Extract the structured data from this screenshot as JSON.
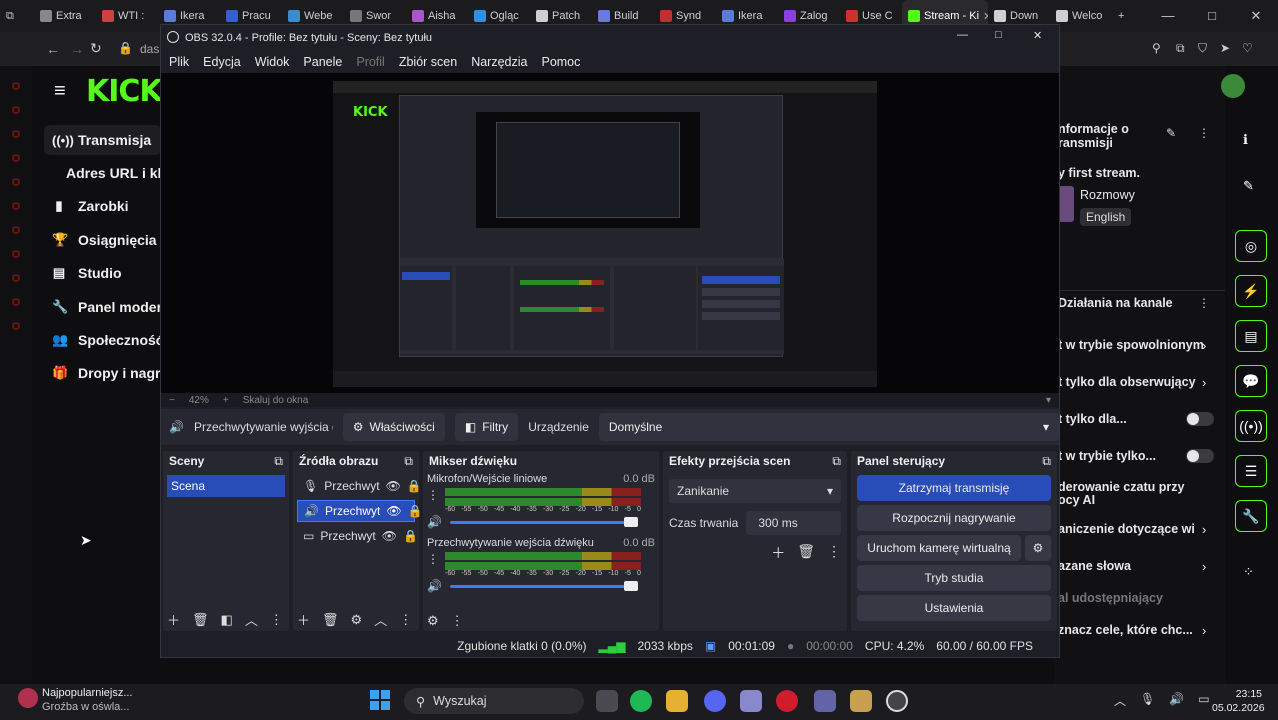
{
  "browser": {
    "tabs": [
      {
        "label": "Extra",
        "color": "#888888"
      },
      {
        "label": "WTI :",
        "color": "#d04040"
      },
      {
        "label": "Ikera",
        "color": "#5a7bd8"
      },
      {
        "label": "Pracu",
        "color": "#3460d0"
      },
      {
        "label": "Webe",
        "color": "#3a8ad0"
      },
      {
        "label": "Swor",
        "color": "#777777"
      },
      {
        "label": "Aisha",
        "color": "#aa55cc"
      },
      {
        "label": "Ogląc",
        "color": "#3090e0"
      },
      {
        "label": "Patch",
        "color": "#cfcfcf"
      },
      {
        "label": "Build",
        "color": "#6c7ae0"
      },
      {
        "label": "Synd",
        "color": "#c03030"
      },
      {
        "label": "Ikera",
        "color": "#5a7bd8"
      },
      {
        "label": "Zalog",
        "color": "#8a40e0"
      },
      {
        "label": "Use C",
        "color": "#d03030"
      },
      {
        "label": "Stream - Ki",
        "color": "#53fc18"
      },
      {
        "label": "Down",
        "color": "#cfcfcf"
      },
      {
        "label": "Welco",
        "color": "#cfcfcf"
      }
    ],
    "new_tab": "+",
    "address_text": "das"
  },
  "kick": {
    "logo": "KICK",
    "nav": [
      {
        "label": "Transmisja",
        "icon": "((•))",
        "active": true
      },
      {
        "label": "Adres URL i klu",
        "icon": "",
        "active": false
      },
      {
        "label": "Zarobki",
        "icon": "▮",
        "active": false
      },
      {
        "label": "Osiągnięcia",
        "icon": "🏆",
        "active": false
      },
      {
        "label": "Studio",
        "icon": "▤",
        "active": false
      },
      {
        "label": "Panel moder",
        "icon": "🔧",
        "active": false
      },
      {
        "label": "Społeczność",
        "icon": "👥",
        "active": false
      },
      {
        "label": "Dropy i nagro",
        "icon": "🎁",
        "active": false
      }
    ],
    "right_panel": {
      "info_title_1": "nformacje o",
      "info_title_2": "ransmisji",
      "stream_title": "y first stream.",
      "category": "Rozmowy",
      "language": "English",
      "channel_actions": "Działania na kanale",
      "options": [
        "t w trybie spowolnionym",
        "t tylko dla obserwujący",
        "t tylko dla...",
        "t w trybie tylko...",
        "derowanie czatu przy",
        "ocy AI",
        "aniczenie dotyczące wi",
        "azane słowa",
        "al udostępniający",
        "znacz cele, które chc..."
      ]
    }
  },
  "obs": {
    "title": "OBS 32.0.4 - Profile: Bez tytułu - Sceny: Bez tytułu",
    "menu": [
      "Plik",
      "Edycja",
      "Widok",
      "Panele",
      "Profil",
      "Zbiór scen",
      "Narzędzia",
      "Pomoc"
    ],
    "zoom": "42%",
    "scale_label": "Skaluj do okna",
    "context": {
      "source": "Przechwytywanie wyjścia d",
      "properties": "Właściwości",
      "filters": "Filtry",
      "device_label": "Urządzenie",
      "device_value": "Domyślne"
    },
    "docks": {
      "scenes": {
        "title": "Sceny",
        "items": [
          "Scena"
        ]
      },
      "sources": {
        "title": "Źródła obrazu",
        "items": [
          "Przechwyt",
          "Przechwyt",
          "Przechwyt"
        ]
      },
      "mixer": {
        "title": "Mikser dźwięku",
        "channels": [
          {
            "name": "Mikrofon/Wejście liniowe",
            "db": "0.0 dB"
          },
          {
            "name": "Przechwytywanie wejścia dźwięku",
            "db": "0.0 dB"
          }
        ],
        "ticks": [
          "-60",
          "-55",
          "-50",
          "-45",
          "-40",
          "-35",
          "-30",
          "-25",
          "-20",
          "-15",
          "-10",
          "-5",
          "0"
        ]
      },
      "transitions": {
        "title": "Efekty przejścia scen",
        "effect": "Zanikanie",
        "duration_label": "Czas trwania",
        "duration_value": "300 ms"
      },
      "controls": {
        "title": "Panel sterujący",
        "stop_stream": "Zatrzymaj transmisję",
        "start_record": "Rozpocznij nagrywanie",
        "virtual_cam": "Uruchom kamerę wirtualną",
        "studio_mode": "Tryb studia",
        "settings": "Ustawienia"
      }
    },
    "status": {
      "dropped": "Zgubione klatki 0 (0.0%)",
      "bitrate": "2033 kbps",
      "stream_time": "00:01:09",
      "rec_time": "00:00:00",
      "cpu": "CPU: 4.2%",
      "fps": "60.00 / 60.00 FPS"
    }
  },
  "taskbar": {
    "notification_title": "Najpopularniejsz...",
    "notification_sub": "Groźba w ośwla...",
    "search": "Wyszukaj",
    "time": "23:15",
    "date": "05.02.2026"
  },
  "colors": {
    "kick_green": "#53fc18",
    "obs_blue": "#284cb8",
    "obs_bg": "#1e1f26"
  }
}
